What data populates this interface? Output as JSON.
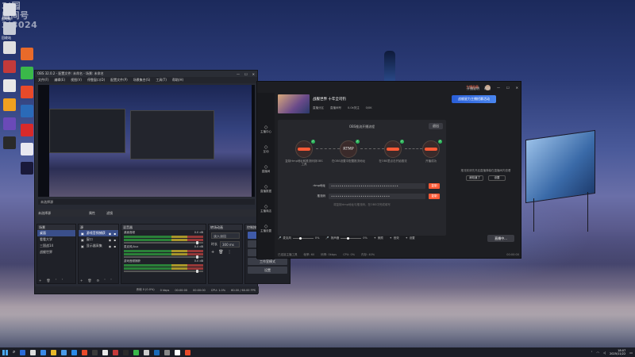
{
  "desktop": {
    "watermark_line1": "3|园",
    "watermark_line2": "盾间号",
    "watermark_line3": "3|8024",
    "icons": [
      {
        "label": "此电脑",
        "color": "#d9dce4"
      },
      {
        "label": "回收站",
        "color": "#c6cbd6"
      },
      {
        "label": "",
        "color": "#e0e0e0"
      },
      {
        "label": "",
        "color": "#c43a3a"
      },
      {
        "label": "",
        "color": "#e8e8e8"
      },
      {
        "label": "",
        "color": "#f0a020"
      },
      {
        "label": "",
        "color": "#6a4ab8"
      },
      {
        "label": "",
        "color": "#2a2a2a"
      },
      {
        "label": "",
        "color": "#e86a2a"
      },
      {
        "label": "",
        "color": "#3ab84a"
      },
      {
        "label": "",
        "color": "#e84a2a"
      },
      {
        "label": "",
        "color": "#2a6ab8"
      },
      {
        "label": "",
        "color": "#d82a2a"
      },
      {
        "label": "",
        "color": "#e8e8f0"
      },
      {
        "label": "",
        "color": "#1a1a3a"
      }
    ]
  },
  "obs": {
    "title": "OBS 32.0.2 - 配置文件: 未命名 - 场景: 未命名",
    "menu": [
      "文件(F)",
      "编辑(E)",
      "视图(V)",
      "停靠窗口(D)",
      "配置文件(P)",
      "场景集合(S)",
      "工具(T)",
      "帮助(H)"
    ],
    "source_bar": [
      "未选择源",
      "属性",
      "滤镜"
    ],
    "scene_tabs": {
      "scenes": "场景",
      "sources": "来源",
      "mixer": "混音器",
      "transitions": "转场动画",
      "controls": "控制按钮"
    },
    "scenes_header": "场景",
    "scenes": [
      "桌面",
      "看看大学",
      "三国战14",
      "战舰世界"
    ],
    "sources_header": "源",
    "sources": [
      "游戏音频捕获",
      "窗口",
      "显示器采集"
    ],
    "mixer_header": "混音器",
    "mixer_channels": [
      {
        "name": "桌面音频",
        "level": "0.0 dB"
      },
      {
        "name": "麦克风/Aux",
        "level": "0.0 dB"
      },
      {
        "name": "游戏音频捕获",
        "level": "0.0 dB"
      }
    ],
    "transitions_header": "转场动画",
    "transition_type": "淡入淡出",
    "transition_duration_label": "时长",
    "transition_duration": "300 ms",
    "controls_header": "控制按钮",
    "controls": [
      "开始直播",
      "开始录制",
      "启动虚拟摄像机",
      "工作室模式",
      "设置"
    ],
    "status": [
      "丢帧 0 (0.0%)",
      "0 kbps",
      "00:00:00",
      "00:00:00",
      "CPU: 1.0%",
      "60.00 / 60.00 FPS"
    ]
  },
  "live": {
    "badge": "主播勋章",
    "top_right": [
      "开播说明",
      "帮助"
    ],
    "sidebar": [
      "主播中心",
      "互动",
      "直播间",
      "直播数据",
      "主播商店",
      "主播设置"
    ],
    "stream_title": "战舰世界 十年全司钓",
    "stream_meta": [
      "直播分区",
      "直播间号",
      "0.0k关注",
      "0/0K"
    ],
    "promo": "战舰星力主播招募活动",
    "panel_title": "OBS推流开播流程",
    "panel_button": "退出",
    "steps": [
      {
        "label": "复制rtmp地址和推流码到OBS工具"
      },
      {
        "label": "在OBS设置中配置推流地址",
        "tag": "RTMP"
      },
      {
        "label": "在OBS里点击开始推流"
      },
      {
        "label": "开播成功"
      }
    ],
    "rtmp_label": "rtmp地址",
    "rtmp_value": "••••••••••••••••••••••••••••••••",
    "key_label": "推流码",
    "key_value": "••••••••••••••••••••••••••••",
    "copy_label": "复制",
    "hint": "将复制rtmp地址与推流码，在OBS中完成填写",
    "right_text": "推流前请先开启直播弹幕在直播间内查看",
    "right_buttons": [
      "我知道了",
      "设置"
    ],
    "controls": [
      {
        "name": "麦克风",
        "value": "0%"
      },
      {
        "name": "扬声器",
        "value": "0%"
      },
      {
        "name": "美颜",
        "value": ""
      },
      {
        "name": "音效",
        "value": ""
      },
      {
        "name": "设置",
        "value": ""
      }
    ],
    "live_button": "直播中...",
    "status": [
      "已连接主播工具",
      "帧率: 60",
      "码率: 0kbps",
      "CPU: 0%",
      "内存: 40%",
      "00:00:00"
    ]
  },
  "taskbar": {
    "icons": [
      "#2a6ad8",
      "#dddddd",
      "#3a8ae8",
      "#e8b82a",
      "#4a9ae8",
      "#2a8ae8",
      "#e84a2a",
      "#3a3a3a",
      "#e8e8e8",
      "#c43a3a",
      "#2a2a2a",
      "#3ab84a",
      "#cccccc",
      "#1a6ab8",
      "#888888",
      "#ffffff",
      "#e84a2a"
    ],
    "time": "18:07",
    "date": "2025/11/22"
  }
}
